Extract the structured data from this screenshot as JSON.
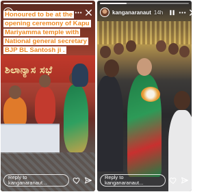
{
  "stories": [
    {
      "username": "kanganaranaut",
      "timestamp": "",
      "caption": "Honoured to be at the opening ceremony of Kapu Mariyamma temple with National general secretary BJP BL Santosh ji .",
      "background_banner_text": "ಶಿಲಾನ್ಯಾಸ ಸಭೆ",
      "reply_placeholder": "Reply to kanganaranaut...",
      "progress": 1.0,
      "icons": [
        "more-icon",
        "close-icon",
        "heart-icon",
        "send-icon"
      ]
    },
    {
      "username": "kanganaranaut",
      "timestamp": "14h",
      "caption": "",
      "reply_placeholder": "Reply to kanganaranaut...",
      "progress": 0.3,
      "icons": [
        "pause-icon",
        "more-icon",
        "close-icon",
        "heart-icon",
        "send-icon"
      ]
    }
  ],
  "colors": {
    "caption_text": "#f08a24",
    "caption_bg": "#ffffff"
  }
}
